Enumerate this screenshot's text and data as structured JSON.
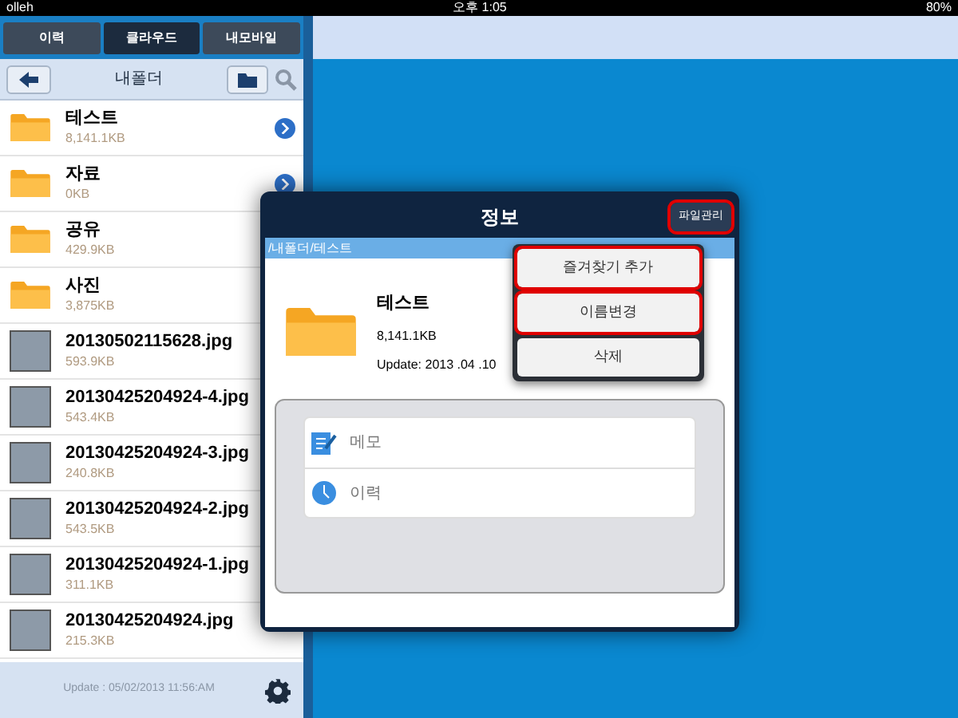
{
  "status_bar": {
    "carrier": "olleh",
    "time": "오후 1:05",
    "battery": "80%"
  },
  "tabs": [
    {
      "label": "이력",
      "selected": false
    },
    {
      "label": "클라우드",
      "selected": true
    },
    {
      "label": "내모바일",
      "selected": false
    }
  ],
  "nav": {
    "title": "내폴더"
  },
  "files": [
    {
      "kind": "folder",
      "name": "테스트",
      "size": "8,141.1KB",
      "detail_button": true
    },
    {
      "kind": "folder",
      "name": "자료",
      "size": "0KB",
      "detail_button": true
    },
    {
      "kind": "folder",
      "name": "공유",
      "size": "429.9KB"
    },
    {
      "kind": "folder",
      "name": "사진",
      "size": "3,875KB"
    },
    {
      "kind": "image",
      "name": "20130502115628.jpg",
      "size": "593.9KB"
    },
    {
      "kind": "image",
      "name": "20130425204924-4.jpg",
      "size": "543.4KB"
    },
    {
      "kind": "image",
      "name": "20130425204924-3.jpg",
      "size": "240.8KB"
    },
    {
      "kind": "image",
      "name": "20130425204924-2.jpg",
      "size": "543.5KB"
    },
    {
      "kind": "image",
      "name": "20130425204924-1.jpg",
      "size": "311.1KB"
    },
    {
      "kind": "image",
      "name": "20130425204924.jpg",
      "size": "215.3KB"
    }
  ],
  "footer": {
    "update": "Update : 05/02/2013 11:56:AM"
  },
  "dialog": {
    "title": "정보",
    "manage_button": "파일관리",
    "path": "/내폴더/테스트",
    "name": "테스트",
    "size": "8,141.1KB",
    "updated": "Update: 2013 .04 .10",
    "menu": [
      {
        "label": "즐겨찾기 추가",
        "highlighted": true
      },
      {
        "label": "이름변경",
        "highlighted": true
      },
      {
        "label": "삭제",
        "highlighted": false
      }
    ],
    "options": [
      {
        "kind": "memo",
        "label": "메모"
      },
      {
        "kind": "history",
        "label": "이력"
      }
    ]
  }
}
